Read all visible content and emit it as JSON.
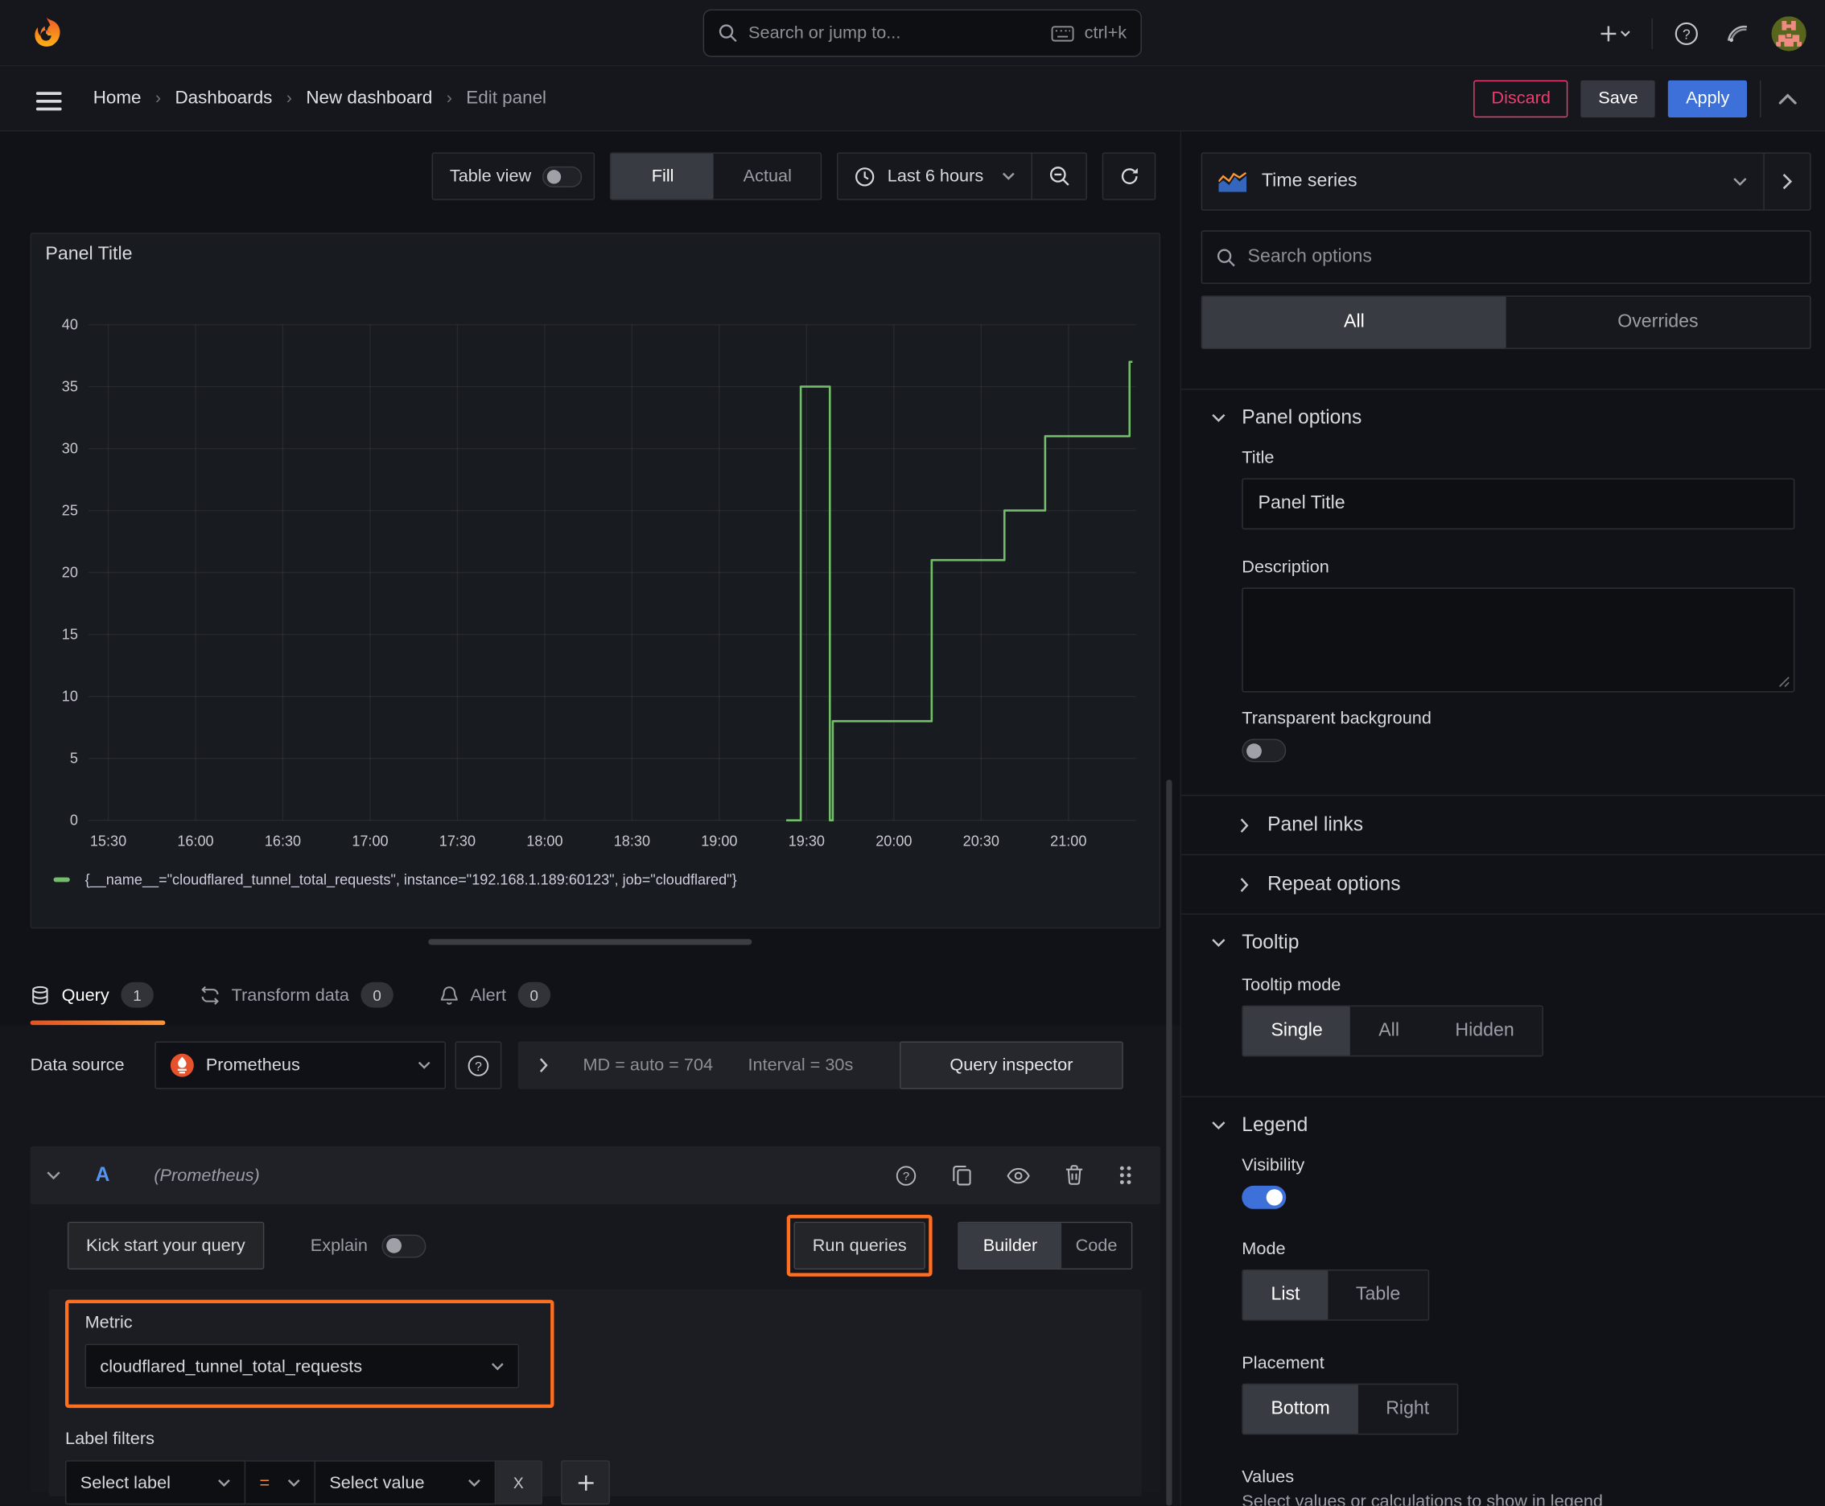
{
  "topbar": {
    "search_placeholder": "Search or jump to...",
    "search_shortcut": "ctrl+k"
  },
  "breadcrumb": {
    "separator": "›",
    "items": [
      "Home",
      "Dashboards",
      "New dashboard"
    ],
    "current": "Edit panel"
  },
  "header_actions": {
    "discard": "Discard",
    "save": "Save",
    "apply": "Apply"
  },
  "toolbar": {
    "table_view": "Table view",
    "fill": "Fill",
    "actual": "Actual",
    "time_range": "Last 6 hours"
  },
  "viz_picker": {
    "label": "Time series"
  },
  "panel": {
    "title": "Panel Title",
    "legend": "{__name__=\"cloudflared_tunnel_total_requests\", instance=\"192.168.1.189:60123\", job=\"cloudflared\"}"
  },
  "chart_data": {
    "type": "line",
    "line_style": "step",
    "title": "Panel Title",
    "series": [
      {
        "name": "{__name__=\"cloudflared_tunnel_total_requests\", instance=\"192.168.1.189:60123\", job=\"cloudflared\"}",
        "color": "#73bf69",
        "points": [
          [
            "19:23",
            0
          ],
          [
            "19:28",
            35
          ],
          [
            "19:38",
            0
          ],
          [
            "19:39",
            8
          ],
          [
            "20:13",
            21
          ],
          [
            "20:38",
            25
          ],
          [
            "20:52",
            31
          ],
          [
            "21:21",
            37
          ]
        ],
        "x_end": "21:22"
      }
    ],
    "x_ticks": [
      "15:30",
      "16:00",
      "16:30",
      "17:00",
      "17:30",
      "18:00",
      "18:30",
      "19:00",
      "19:30",
      "20:00",
      "20:30",
      "21:00"
    ],
    "y_ticks": [
      0,
      5,
      10,
      15,
      20,
      25,
      30,
      35,
      40
    ],
    "ylim": [
      0,
      42
    ],
    "x_range": [
      "15:22",
      "21:22"
    ],
    "grid": true,
    "legend_position": "bottom"
  },
  "query_tabs": {
    "query": "Query",
    "query_count": "1",
    "transform": "Transform data",
    "transform_count": "0",
    "alert": "Alert",
    "alert_count": "0"
  },
  "datasource_row": {
    "label": "Data source",
    "name": "Prometheus",
    "stats": "MD = auto = 704",
    "interval": "Interval = 30s",
    "inspector": "Query inspector"
  },
  "query_editor": {
    "ref_id": "A",
    "ds_hint": "(Prometheus)",
    "kick_start": "Kick start your query",
    "explain": "Explain",
    "run_queries": "Run queries",
    "builder": "Builder",
    "code": "Code",
    "metric_label": "Metric",
    "metric_value": "cloudflared_tunnel_total_requests",
    "label_filters": "Label filters",
    "select_label": "Select label",
    "operator": "=",
    "select_value": "Select value",
    "remove": "X"
  },
  "sidebar": {
    "search_placeholder": "Search options",
    "tabs": {
      "all": "All",
      "overrides": "Overrides"
    },
    "panel_options": {
      "title": "Panel options",
      "title_label": "Title",
      "title_value": "Panel Title",
      "description_label": "Description",
      "transparent_label": "Transparent background"
    },
    "collapsed": {
      "panel_links": "Panel links",
      "repeat_options": "Repeat options"
    },
    "tooltip": {
      "title": "Tooltip",
      "mode_label": "Tooltip mode",
      "options": [
        "Single",
        "All",
        "Hidden"
      ]
    },
    "legend": {
      "title": "Legend",
      "visibility_label": "Visibility",
      "mode_label": "Mode",
      "mode_options": [
        "List",
        "Table"
      ],
      "placement_label": "Placement",
      "placement_options": [
        "Bottom",
        "Right"
      ],
      "values_label": "Values",
      "values_hint": "Select values or calculations to show in legend"
    }
  },
  "colors": {
    "accent_orange": "#ff6f1f",
    "series_green": "#73bf69",
    "primary_blue": "#3d71d9",
    "discard_pink": "#ef3b6d",
    "background": "#111217"
  }
}
